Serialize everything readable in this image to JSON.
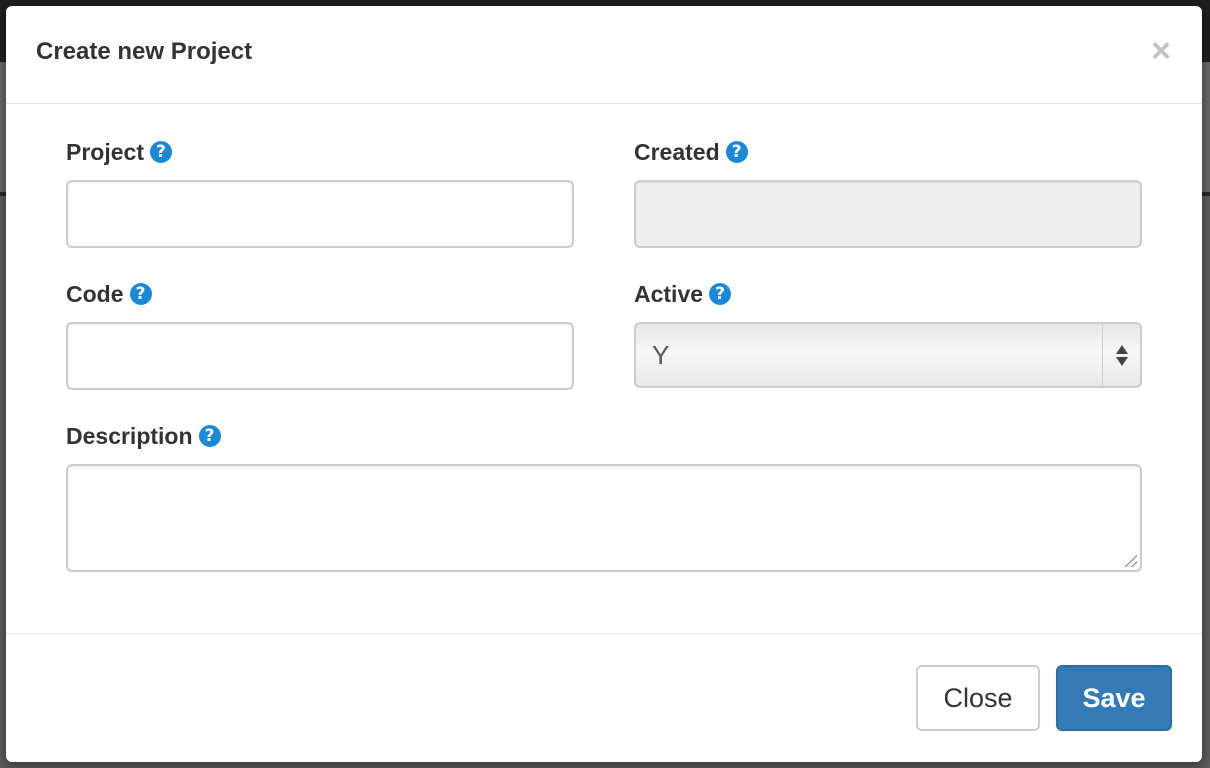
{
  "modal": {
    "title": "Create new Project",
    "close_icon": "close-icon"
  },
  "form": {
    "project": {
      "label": "Project",
      "value": ""
    },
    "created": {
      "label": "Created",
      "value": ""
    },
    "code": {
      "label": "Code",
      "value": ""
    },
    "active": {
      "label": "Active",
      "value": "Y"
    },
    "description": {
      "label": "Description",
      "value": ""
    },
    "help_glyph": "?"
  },
  "footer": {
    "close_label": "Close",
    "save_label": "Save"
  },
  "colors": {
    "primary": "#337ab7",
    "help_icon": "#1a8ad8",
    "disabled_bg": "#eeeeee"
  }
}
